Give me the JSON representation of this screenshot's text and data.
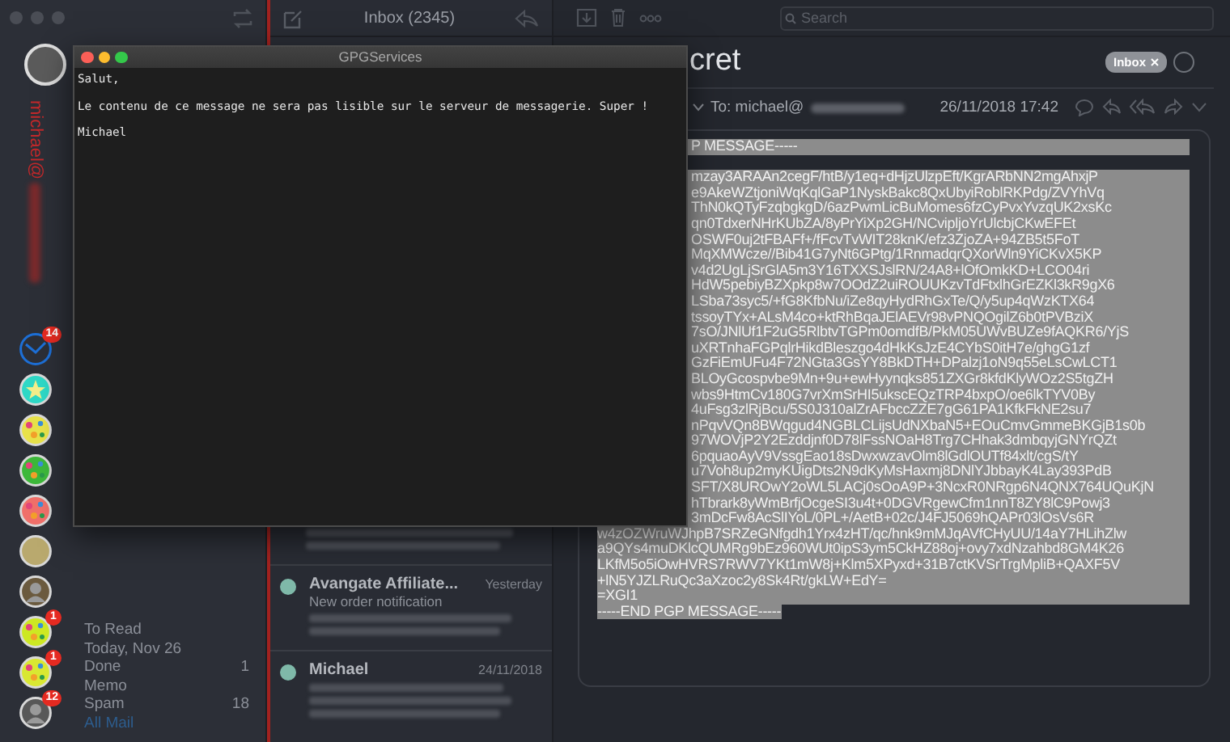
{
  "sidebar": {
    "account_email": "michael@",
    "accounts": [
      {
        "kind": "mail",
        "color": "#1d6fd6",
        "badge": "14"
      },
      {
        "kind": "star",
        "color": "#2ed8c6"
      },
      {
        "kind": "pattern",
        "color": "#e8e24a"
      },
      {
        "kind": "pattern",
        "color": "#3db83a"
      },
      {
        "kind": "pattern",
        "color": "#f0706a"
      },
      {
        "kind": "plain",
        "color": "#b9a96e"
      },
      {
        "kind": "photo",
        "color": "#6b5a3e"
      },
      {
        "kind": "pattern",
        "color": "#cde823",
        "badge": "1"
      },
      {
        "kind": "pattern",
        "color": "#d9e832",
        "badge": "1"
      },
      {
        "kind": "photo",
        "color": "#585858",
        "badge": "12"
      }
    ],
    "folders": [
      {
        "label": "To Read",
        "selected": false
      },
      {
        "label": "Today, Nov 26",
        "selected": false
      },
      {
        "label": "Done",
        "count": "1",
        "selected": false
      },
      {
        "label": "Memo",
        "selected": false
      },
      {
        "label": "Spam",
        "count": "18",
        "selected": false
      },
      {
        "label": "All Mail",
        "selected": true
      }
    ]
  },
  "message_list": {
    "title": "Inbox (2345)",
    "items": [
      {
        "sender": "Avangate Affiliate...",
        "date": "Yesterday",
        "subject": "New order notification"
      },
      {
        "sender": "Michael",
        "date": "24/11/2018"
      }
    ]
  },
  "reader": {
    "search": {
      "placeholder": "Search"
    },
    "subject": "cret",
    "tag": {
      "label": "Inbox"
    },
    "to_label": "To: michael@",
    "date": "26/11/2018 17:42",
    "message": {
      "selected": true,
      "lines": [
        {
          "text": "P MESSAGE-----",
          "covered": true
        },
        {
          "text": "mzay3ARAAn2cegF/htB/y1eq+dHjzUlzpEft/KgrARbNN2mgAhxjP",
          "covered": true
        },
        {
          "text": "e9AkeWZtjoniWqKqlGaP1NyskBakc8QxUbyiRoblRKPdg/ZVYhVq",
          "covered": true
        },
        {
          "text": "ThN0kQTyFzqbgkgD/6azPwmLicBuMomes6fzCyPvxYvzqUK2xsKc",
          "covered": true
        },
        {
          "text": "qn0TdxerNHrKUbZA/8yPrYiXp2GH/NCvipljoYrUlcbjCKwEFEt",
          "covered": true
        },
        {
          "text": "OSWF0uj2tFBAFf+/fFcvTvWIT28knK/efz3ZjoZA+94ZB5t5FoT",
          "covered": true
        },
        {
          "text": "MqXMWcze//Bib41G7yNt6GPtg/1RnmadqrQXorWln9YiCKvX5KP",
          "covered": true
        },
        {
          "text": "v4d2UgLjSrGlA5m3Y16TXXSJslRN/24A8+lOfOmkKD+LCO04ri",
          "covered": true
        },
        {
          "text": "HdW5pebiyBZXpkp8w7OOdZ2uiROUUKzvTdFtxlhGrEZKl3kR9gX6",
          "covered": true
        },
        {
          "text": "LSba73syc5/+fG8KfbNu/iZe8qyHydRhGxTe/Q/y5up4qWzKTX64",
          "covered": true
        },
        {
          "text": "tssoyTYx+ALsM4co+ktRhBqaJElAEVr98vPNQOgilZ6b0tPVBziX",
          "covered": true
        },
        {
          "text": "7sO/JNlUf1F2uG5RlbtvTGPm0omdfB/PkM05UWvBUZe9fAQKR6/YjS",
          "covered": true
        },
        {
          "text": "uXRTnhaFGPqlrHikdBleszgo4dHkKsJzE4CYbS0itH7e/ghgG1zf",
          "covered": true
        },
        {
          "text": "GzFiEmUFu4F72NGta3GsYY8BkDTH+DPalzj1oN9q55eLsCwLCT1",
          "covered": true
        },
        {
          "text": "BLOyGcospvbe9Mn+9u+ewHyynqks851ZXGr8kfdKlyWOz2S5tgZH",
          "covered": true
        },
        {
          "text": "wbs9HtmCv180G7vrXmSrHI5ukscEQzTRP4bxpO/oe6lkTYV0By",
          "covered": true
        },
        {
          "text": "4uFsg3zlRjBcu/5S0J310alZrAFbccZZE7gG61PA1KfkFkNE2su7",
          "covered": true
        },
        {
          "text": "nPqvVQn8BWqgud4NGBLCLijsUdNXbaN5+EOuCmvGmmeBKGjB1s0b",
          "covered": true
        },
        {
          "text": "97WOVjP2Y2Ezddjnf0D78lFssNOaH8Trg7CHhak3dmbqyjGNYrQZt",
          "covered": true
        },
        {
          "text": "6pquaoAyV9VssgEao18sDwxwzavOlm8lGdlOUTf84xlt/cgS/tY",
          "covered": true
        },
        {
          "text": "u7Voh8up2myKUigDts2N9dKyMsHaxmj8DNlYJbbayK4Lay393PdB",
          "covered": true
        },
        {
          "text": "SFT/X8UROwY2oWL5LACj0sOoA9P+3NcxR0NRgp6N4QNX764UQuKjN",
          "covered": true
        },
        {
          "text": "hTbrark8yWmBrfjOcgeSI3u4t+0DGVRgewCfm1nnT8ZY8lC9Powj3",
          "covered": true
        },
        {
          "text": "3mDcFw8AcSlIYoL/0PL+/AetB+02c/J4FJ5069hQAPr03lOsVs6R",
          "covered": true
        },
        {
          "text": "w4zOZWruWJhpB7SRZeGNfgdh1Yrx4zHT/qc/hnk9mMJqAVfCHyUU/14aY7HLihZlw",
          "covered": false
        },
        {
          "text": "a9QYs4muDKlcQUMRg9bEz960WUt0ipS3ym5CkHZ88oj+ovy7xdNzahbd8GM4K26",
          "covered": false
        },
        {
          "text": "LKfM5o5iOwHVRS7RWV7YKt1mW8j+Klm5XPyxd+31B7ctKVSrTrgMpliB+QAXF5V",
          "covered": false
        },
        {
          "text": "+lN5YJZLRuQc3aXzoc2y8Sk4Rt/gkLW+EdY=",
          "covered": false
        },
        {
          "text": "=XGI1",
          "covered": false
        },
        {
          "text": "-----END PGP MESSAGE-----",
          "covered": false
        }
      ]
    }
  },
  "gpg_window": {
    "title": "GPGServices",
    "paragraphs": [
      "Salut,",
      "Le contenu de ce message ne sera pas lisible sur le serveur de messagerie. Super !",
      "Michael"
    ]
  }
}
